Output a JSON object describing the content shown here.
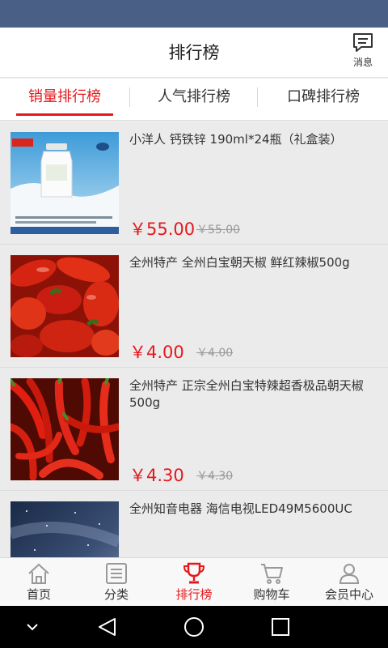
{
  "header": {
    "title": "排行榜",
    "message_label": "消息"
  },
  "tabs": [
    {
      "label": "销量排行榜",
      "active": true
    },
    {
      "label": "人气排行榜",
      "active": false
    },
    {
      "label": "口碑排行榜",
      "active": false
    }
  ],
  "products": [
    {
      "title": "小洋人 钙铁锌 190ml*24瓶（礼盒装）",
      "price": "￥55.00",
      "old_price": "￥55.00",
      "image": "milk-bottle-image"
    },
    {
      "title": "全州特产 全州白宝朝天椒 鲜红辣椒500g",
      "price": "￥4.00",
      "old_price": "￥4.00",
      "image": "red-peppers-image"
    },
    {
      "title": "全州特产 正宗全州白宝特辣超香极品朝天椒500g",
      "price": "￥4.30",
      "old_price": "￥4.30",
      "image": "chili-peppers-image"
    },
    {
      "title": "全州知音电器  海信电视LED49M5600UC",
      "image": "starry-sky-tv-image"
    }
  ],
  "bottom_nav": [
    {
      "label": "首页",
      "icon": "home-icon",
      "active": false
    },
    {
      "label": "分类",
      "icon": "list-icon",
      "active": false
    },
    {
      "label": "排行榜",
      "icon": "trophy-icon",
      "active": true
    },
    {
      "label": "购物车",
      "icon": "cart-icon",
      "active": false
    },
    {
      "label": "会员中心",
      "icon": "user-icon",
      "active": false
    }
  ],
  "colors": {
    "accent": "#e5191d",
    "status_bar": "#4a5f86"
  }
}
